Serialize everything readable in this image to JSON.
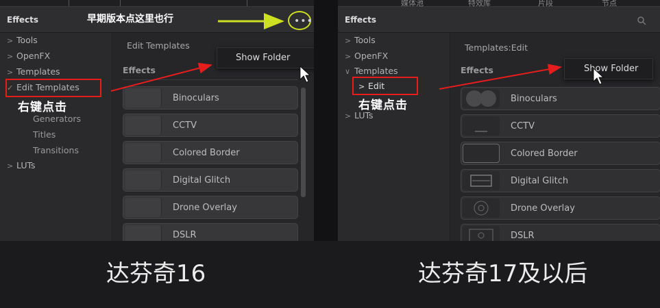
{
  "left": {
    "toolbar_text": "",
    "header_title": "Effects",
    "tree": [
      {
        "arrow": ">",
        "label": "Tools"
      },
      {
        "arrow": ">",
        "label": "OpenFX"
      },
      {
        "arrow": ">",
        "label": "Templates"
      },
      {
        "arrow": "✓",
        "label": "Edit Templates"
      }
    ],
    "tree_sub": [
      "Generators",
      "Titles",
      "Transitions"
    ],
    "tree_tail": {
      "arrow": ">",
      "label": "LUTs"
    },
    "path": "Edit Templates",
    "section": "Effects",
    "effects": [
      "Binoculars",
      "CCTV",
      "Colored Border",
      "Digital Glitch",
      "Drone Overlay",
      "DSLR"
    ],
    "menu_item": "Show Folder",
    "note_top": "早期版本点这里也行",
    "right_click_note": "右键点击",
    "dots": "•••",
    "caption": "达芬奇16"
  },
  "right": {
    "toolbar_items": [
      "媒体池",
      "特效库",
      "片段",
      "节点"
    ],
    "header_title": "Effects",
    "tree": [
      {
        "arrow": ">",
        "label": "Tools"
      },
      {
        "arrow": ">",
        "label": "OpenFX"
      },
      {
        "arrow": "∨",
        "label": "Templates"
      }
    ],
    "tree_edit": {
      "arrow": ">",
      "label": "Edit"
    },
    "tree_tail": {
      "arrow": ">",
      "label": "LUTs"
    },
    "path": "Templates:Edit",
    "section": "Effects",
    "effects": [
      "Binoculars",
      "CCTV",
      "Colored Border",
      "Digital Glitch",
      "Drone Overlay",
      "DSLR"
    ],
    "menu_item": "Show Folder",
    "right_click_note": "右键点击",
    "caption": "达芬奇17及以后"
  },
  "colors": {
    "annotation_red": "#e51d1d",
    "highlight_yellow": "#cde022",
    "panel_bg": "#28282b"
  }
}
